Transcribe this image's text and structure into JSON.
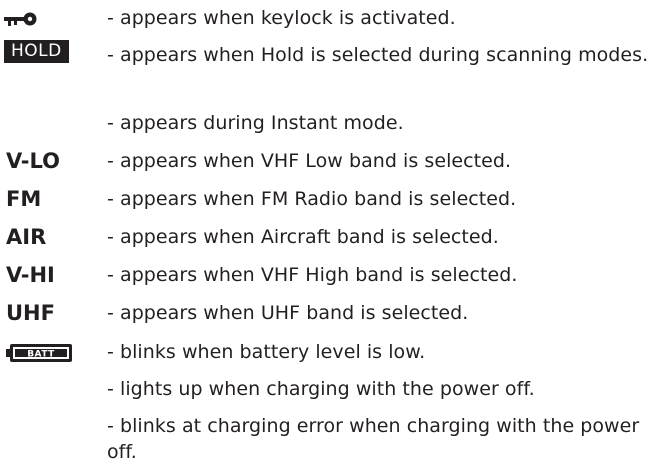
{
  "legend": {
    "items": [
      {
        "label": "",
        "icon": "key-icon",
        "desc": "- appears when keylock is activated."
      },
      {
        "label": "HOLD",
        "icon": "hold-badge",
        "desc": "- appears when Hold is selected during scanning modes."
      },
      {
        "label": "",
        "icon": "",
        "desc": "- appears during Instant mode."
      },
      {
        "label": "V-LO",
        "icon": "",
        "desc": "- appears when VHF Low band is selected."
      },
      {
        "label": "FM",
        "icon": "",
        "desc": "- appears when FM Radio band is selected."
      },
      {
        "label": "AIR",
        "icon": "",
        "desc": "- appears when Aircraft band is selected."
      },
      {
        "label": "V-HI",
        "icon": "",
        "desc": "- appears when VHF High band is selected."
      },
      {
        "label": "UHF",
        "icon": "",
        "desc": "- appears when UHF band is selected."
      },
      {
        "label": "BATT",
        "icon": "battery-icon",
        "desc": "- blinks when battery level is low."
      },
      {
        "label": "",
        "icon": "",
        "desc": "- lights up when charging with the power off."
      },
      {
        "label": "",
        "icon": "",
        "desc": "- blinks at charging error when charging with the power off."
      }
    ]
  },
  "colors": {
    "text": "#231f20",
    "badge_bg": "#231f20",
    "badge_text": "#ffffff"
  }
}
